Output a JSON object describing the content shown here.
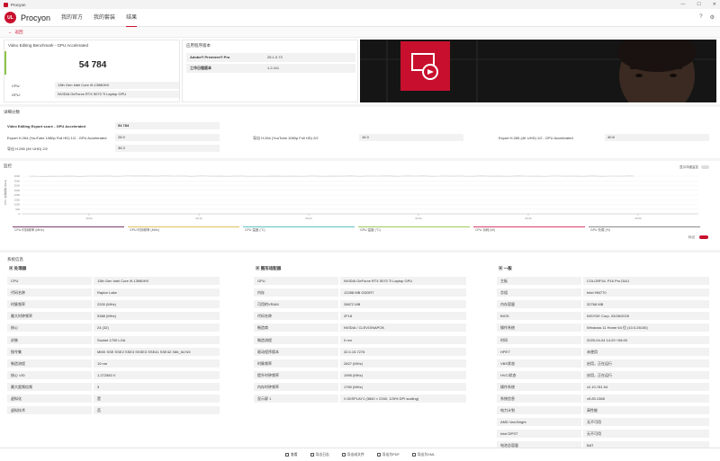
{
  "window": {
    "title": "Procyon"
  },
  "nav": {
    "brand": "Procyon",
    "items": [
      "我的官方",
      "我的套装",
      "结果"
    ],
    "active": 2
  },
  "back": {
    "label": "返回"
  },
  "score_panel": {
    "title": "Video Editing Benchmark - GPU Accelerated",
    "score": "54 784",
    "cpu_label": "CPU:",
    "cpu_value": "13th Gen Intel Core i9-13980HX",
    "gpu_label": "GPU:",
    "gpu_value": "NVIDIA GeForce RTX 5070 Ti Laptop GPU"
  },
  "app_panel": {
    "title": "应用程序版本",
    "rows": [
      {
        "label": "Adobe® Premiere® Pro",
        "value": "25.1.0.73"
      },
      {
        "label": "工作日程版本",
        "value": "1.2.411"
      }
    ]
  },
  "detail": {
    "title": "详细分数",
    "main_label": "Video Editing Export score - GPU Accelerated",
    "main_value": "54 784",
    "items": [
      {
        "label": "Export H.264 (YouTube 1080p Full HD) 1/2 - GPU Accelerated",
        "value": "28.9"
      },
      {
        "label": "导出 H.264 (YouTube 1080p Full HD) 2/2",
        "value": "16.3"
      },
      {
        "label": "Export H.265 (4K UHD) 1/2 - GPU Accelerated",
        "value": "40.8"
      },
      {
        "label": "导出 H.265 (4K UHD) 2/2",
        "value": "36.3"
      }
    ]
  },
  "monitor": {
    "title": "监控",
    "toggle_label": "显示详细监控",
    "y_axis_label": "CPU 时钟频率 (MHz)",
    "y_ticks": [
      "4000",
      "3500",
      "3000",
      "2500",
      "2000",
      "1500",
      "1000",
      "500",
      "0"
    ],
    "x_ticks": [
      "00:00",
      "00:10",
      "00:20",
      "00:30",
      "00:40",
      "00:50"
    ],
    "legend": [
      {
        "label": "CPU 时钟频率 (MHz)",
        "color": "#7b3b6b"
      },
      {
        "label": "GPU 时钟频率 (MHz)",
        "color": "#e2c25a"
      },
      {
        "label": "CPU 温度 (°C)",
        "color": "#5cc5c1"
      },
      {
        "label": "GPU 温度 (°C)",
        "color": "#9fc858"
      },
      {
        "label": "CPU 功耗 (W)",
        "color": "#d93f6a"
      },
      {
        "label": "GPU 负载 (%)",
        "color": "#8a8a8a"
      }
    ],
    "mark_label": "标记",
    "chart_data": {
      "type": "line",
      "ylabel": "CPU 时钟频率 (MHz)",
      "ylim": [
        0,
        4000
      ],
      "x": [
        "00:00",
        "00:10",
        "00:20",
        "00:30",
        "00:40",
        "00:50"
      ],
      "series": [
        {
          "name": "CPU 时钟频率 (MHz)",
          "values": [
            3980,
            4010,
            3990,
            4005,
            3995,
            4000
          ]
        }
      ]
    }
  },
  "sysinfo": {
    "title": "系统信息",
    "cpu": {
      "header": "处理器",
      "rows": [
        [
          "CPU",
          "13th Gen Intel Core i9-13980HX"
        ],
        [
          "代码名称",
          "Raptor Lake"
        ],
        [
          "时脉频率",
          "2200 (MHz)"
        ],
        [
          "最大时钟频率",
          "5388 (MHz)"
        ],
        [
          "核心",
          "24 (32)"
        ],
        [
          "封装",
          "Socket 1700 LGA"
        ],
        [
          "指令集",
          "MMX SSE SSE2 SSE3 SSSE3 SSE41 SSE42 X86_64 NX"
        ],
        [
          "制造流程",
          "10 nm"
        ],
        [
          "核心 VID",
          "1.272583 V"
        ],
        [
          "最大超频倍频",
          "3"
        ],
        [
          "虚拟化",
          "是"
        ],
        [
          "虚拟技术",
          "否"
        ]
      ]
    },
    "gpu": {
      "header": "图形适配器",
      "rows": [
        [
          "GPU",
          "NVIDIA GeForce RTX 5070 Ti Laptop GPU"
        ],
        [
          "内存",
          "12288 MB GDDR7"
        ],
        [
          "可用的VRAM",
          "28672 MB"
        ],
        [
          "代码名称",
          "2F18"
        ],
        [
          "制造商",
          "NVIDIA / CLEVO/NAPOK"
        ],
        [
          "制造流程",
          "0 nm"
        ],
        [
          "驱动程序版本",
          "32.0.15.7276"
        ],
        [
          "时脉频率",
          "2827 (MHz)"
        ],
        [
          "提升时钟频率",
          "1995 (MHz)"
        ],
        [
          "内存时钟频率",
          "1750 (MHz)"
        ],
        [
          "显示屏 1",
          "\\\\.\\DISPLAY1 (3840 × 2160, 125% DPI scaling)"
        ]
      ]
    },
    "general": {
      "header": "一般",
      "rows": [
        [
          "主板",
          "COLORFUL P16 Pro DIA1"
        ],
        [
          "芯组",
          "Intel HM770"
        ],
        [
          "内存容量",
          "32768 MB"
        ],
        [
          "BIOS",
          "INSYDE Corp. 03/28/2025"
        ],
        [
          "操作系统",
          "Windows 11 Home 64 位 (10.0.26100)"
        ],
        [
          "时间",
          "2025-04-04 14:29 +08:00"
        ],
        [
          "HPET",
          "未使用"
        ],
        [
          "VBS状态",
          "启用，正在运行"
        ],
        [
          "HVCI状态",
          "启用，正在运行"
        ],
        [
          "操作系统",
          "v2.10.781 64"
        ],
        [
          "系统信息",
          "v5.83.1368"
        ],
        [
          "电力计划",
          "高性能"
        ],
        [
          "AMD Vari-Bright",
          "无不可用"
        ],
        [
          "Intel DPST",
          "无不可用"
        ],
        [
          "电池总容量",
          "BAT"
        ]
      ]
    }
  },
  "bottom": {
    "items": [
      "查看",
      "导出日志",
      "导出成文件",
      "导出为PDF",
      "导出为XML"
    ]
  }
}
